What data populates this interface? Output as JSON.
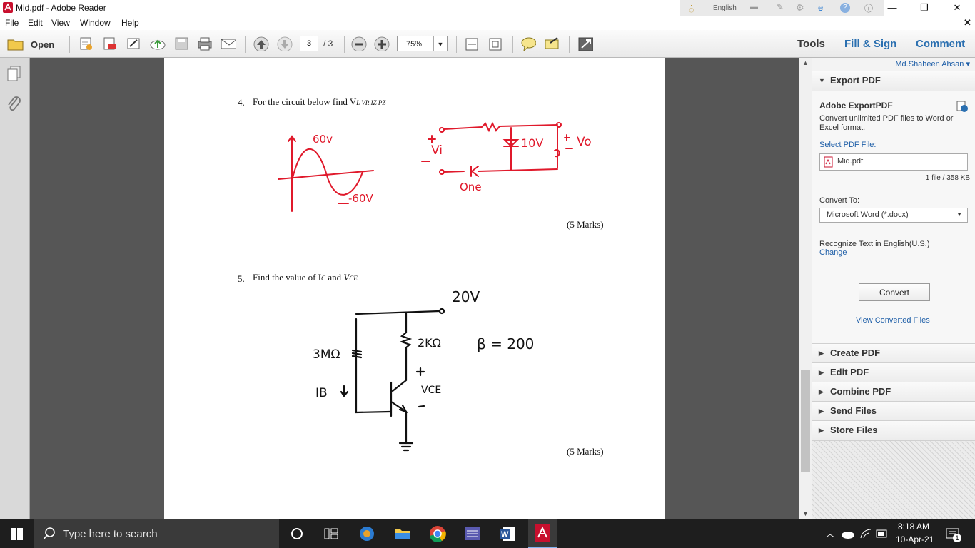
{
  "window": {
    "title": "Mid.pdf - Adobe Reader",
    "lang": "English"
  },
  "menu": [
    "File",
    "Edit",
    "View",
    "Window",
    "Help"
  ],
  "toolbar": {
    "open_label": "Open",
    "page_current": "3",
    "page_total": "/ 3",
    "zoom": "75%",
    "tools": "Tools",
    "fill_sign": "Fill & Sign",
    "comment": "Comment"
  },
  "document": {
    "q4_num": "4.",
    "q4_text": "For the circuit below find V",
    "q4_vars": "L VR IZ PZ",
    "q4_marks": "(5 Marks)",
    "q5_num": "5.",
    "q5_text": "Find the value of I",
    "q5_marks": "(5 Marks)",
    "hand": {
      "v60": "60v",
      "vneg60": "-60V",
      "vi": "Vi",
      "v10": "10V",
      "vo": "Vo",
      "one": "One",
      "v20": "20V",
      "r2k": "2KΩ",
      "r3m": "3MΩ",
      "beta": "β = 200",
      "ib": "IB",
      "vce": "VCE",
      "plus": "+",
      "minus": "-"
    }
  },
  "rightpanel": {
    "user": "Md.Shaheen Ahsan",
    "export_title": "Export PDF",
    "adobe_export": "Adobe ExportPDF",
    "export_desc": "Convert unlimited PDF files to Word or Excel format.",
    "select_label": "Select PDF File:",
    "file_name": "Mid.pdf",
    "file_info": "1 file / 358 KB",
    "convert_to": "Convert To:",
    "format": "Microsoft Word (*.docx)",
    "recognize": "Recognize Text in English(U.S.)",
    "change": "Change",
    "convert_btn": "Convert",
    "view_converted": "View Converted Files",
    "sections": [
      "Create PDF",
      "Edit PDF",
      "Combine PDF",
      "Send Files",
      "Store Files"
    ]
  },
  "taskbar": {
    "search_placeholder": "Type here to search",
    "time": "8:18 AM",
    "date": "10-Apr-21",
    "notif_count": "1"
  },
  "colors": {
    "ink_red": "#e0192b",
    "ink_black": "#111111",
    "link_blue": "#1f5fa8",
    "taskbar": "#1e1e1e"
  }
}
